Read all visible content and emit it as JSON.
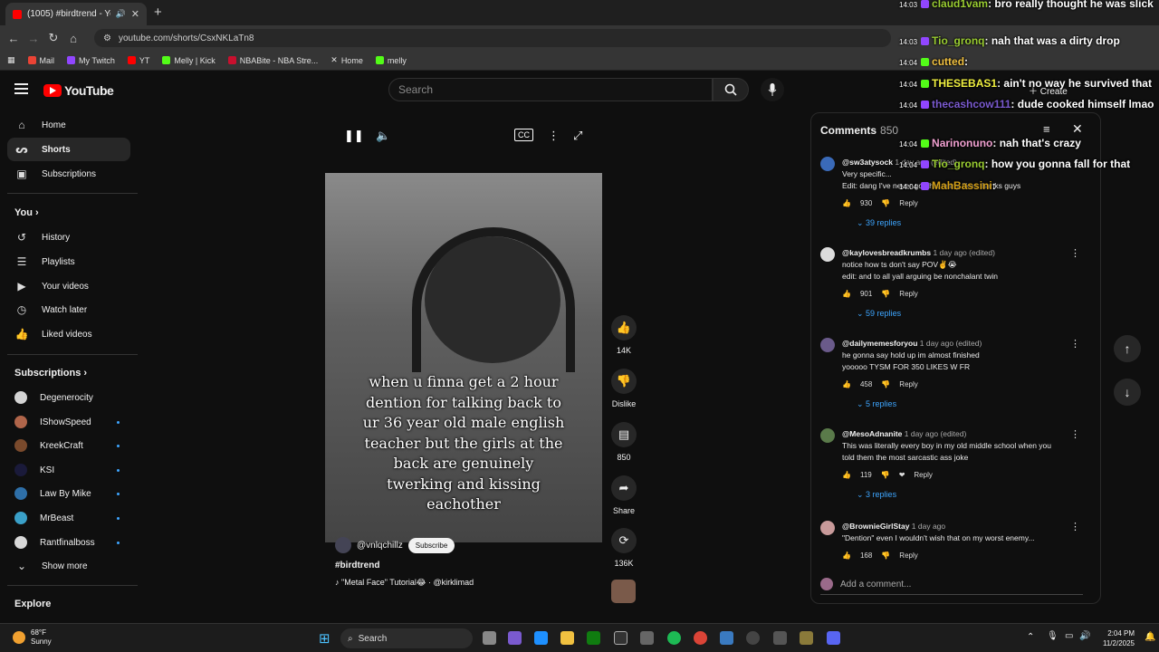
{
  "browser": {
    "tab_title": "(1005) #birdtrend - YouTube",
    "address": "youtube.com/shorts/CsxNKLaTn8",
    "bookmarks": [
      "Mail",
      "My Twitch",
      "YT",
      "Melly | Kick",
      "NBABite - NBA Stre...",
      "Home",
      "melly"
    ]
  },
  "header": {
    "logo_text": "YouTube",
    "search_placeholder": "Search",
    "create_label": "Create"
  },
  "sidebar": {
    "main": [
      {
        "label": "Home",
        "icon": "home-icon"
      },
      {
        "label": "Shorts",
        "icon": "shorts-icon"
      },
      {
        "label": "Subscriptions",
        "icon": "subscriptions-icon"
      }
    ],
    "you_heading": "You",
    "you_items": [
      {
        "label": "History",
        "icon": "history-icon"
      },
      {
        "label": "Playlists",
        "icon": "playlists-icon"
      },
      {
        "label": "Your videos",
        "icon": "videos-icon"
      },
      {
        "label": "Watch later",
        "icon": "clock-icon"
      },
      {
        "label": "Liked videos",
        "icon": "thumbs-up-icon"
      }
    ],
    "subscriptions_heading": "Subscriptions",
    "subscriptions": [
      {
        "label": "Degenerocity",
        "color": "#d4d4d4"
      },
      {
        "label": "IShowSpeed",
        "color": "#b0654a"
      },
      {
        "label": "KreekCraft",
        "color": "#7a4a2c"
      },
      {
        "label": "KSI",
        "color": "#1a1a3a"
      },
      {
        "label": "Law By Mike",
        "color": "#2e6fa8"
      },
      {
        "label": "MrBeast",
        "color": "#3aa0c8"
      },
      {
        "label": "Rantfinalboss",
        "color": "#d8d8d8"
      }
    ],
    "show_more": "Show more",
    "explore_heading": "Explore"
  },
  "video": {
    "caption_lines": [
      "when u finna get a 2 hour",
      "dention for talking back to",
      "ur 36 year old male english",
      "teacher but the girls at the",
      "back are genuinely",
      "twerking and kissing",
      "eachother"
    ],
    "channel": "@vnlqchillz",
    "subscribe": "Subscribe",
    "title": "#birdtrend",
    "music": "\"Metal Face\" Tutorial😂 · @kirklimad",
    "actions": {
      "likes": "14K",
      "dislike": "Dislike",
      "comments": "850",
      "share": "Share",
      "remix": "136K"
    }
  },
  "comments_panel": {
    "title": "Comments",
    "count": "850",
    "comments": [
      {
        "user": "@sw3atysock",
        "time": "1 day ago (edited)",
        "lines": [
          "Very specific...",
          "Edit: dang I've never got this many likes thanks guys"
        ],
        "likes": "930",
        "reply": "Reply",
        "replies": "39 replies",
        "color": "#3a6ab8"
      },
      {
        "user": "@kaylovesbreadkrumbs",
        "time": "1 day ago (edited)",
        "lines": [
          "notice how ts don't say POV✌️😭",
          "edit: and to all yall arguing be nonchalant twin"
        ],
        "likes": "901",
        "reply": "Reply",
        "replies": "59 replies",
        "color": "#dcdcdc"
      },
      {
        "user": "@dailymemesforyou",
        "time": "1 day ago (edited)",
        "lines": [
          "he gonna say  hold up im almost finished",
          "yooooo TYSM FOR 350 LIKES W FR"
        ],
        "likes": "458",
        "reply": "Reply",
        "replies": "5 replies",
        "color": "#6a5a8a"
      },
      {
        "user": "@MesoAdnanite",
        "time": "1 day ago (edited)",
        "lines": [
          "This was literally every boy in my old middle school when you",
          "told them the most sarcastic ass joke"
        ],
        "likes": "119",
        "reply": "Reply",
        "replies": "3 replies",
        "color": "#5a7a4a"
      },
      {
        "user": "@BrownieGirlStay",
        "time": "1 day ago",
        "lines": [
          "\"Dention\" even I wouldn't wish that on my worst enemy..."
        ],
        "likes": "168",
        "reply": "Reply",
        "replies": "",
        "color": "#c89a9a"
      }
    ],
    "add_placeholder": "Add a comment..."
  },
  "chat_overlay": [
    {
      "time": "14:03",
      "user": "claud1vam",
      "msg": ": bro really thought he was slick",
      "color": "#9acd32"
    },
    {
      "time": "14:03",
      "user": "Tio_gronq",
      "msg": ": nah that was a dirty drop",
      "color": "#9acd32"
    },
    {
      "time": "14:04",
      "user": "cutted",
      "msg": ":",
      "color": "#f0c040"
    },
    {
      "time": "14:04",
      "user": "THESEBAS1",
      "msg": ": ain't no way he survived that",
      "color": "#f0f040"
    },
    {
      "time": "14:04",
      "user": "thecashcow111",
      "msg": ": dude cooked himself lmao",
      "color": "#7a5acf"
    },
    {
      "time": "14:04",
      "user": "Narinonuno",
      "msg": ": nah that's crazy",
      "color": "#f0a0d0"
    },
    {
      "time": "14:04",
      "user": "Tio_gronq",
      "msg": ": how you gonna fall for that",
      "color": "#9acd32"
    },
    {
      "time": "14:04",
      "user": "MahBassini",
      "msg": ":",
      "color": "#d4a017"
    }
  ],
  "taskbar": {
    "weather_temp": "68°F",
    "weather_desc": "Sunny",
    "search_label": "Search",
    "time": "2:04 PM",
    "date": "11/2/2025"
  }
}
